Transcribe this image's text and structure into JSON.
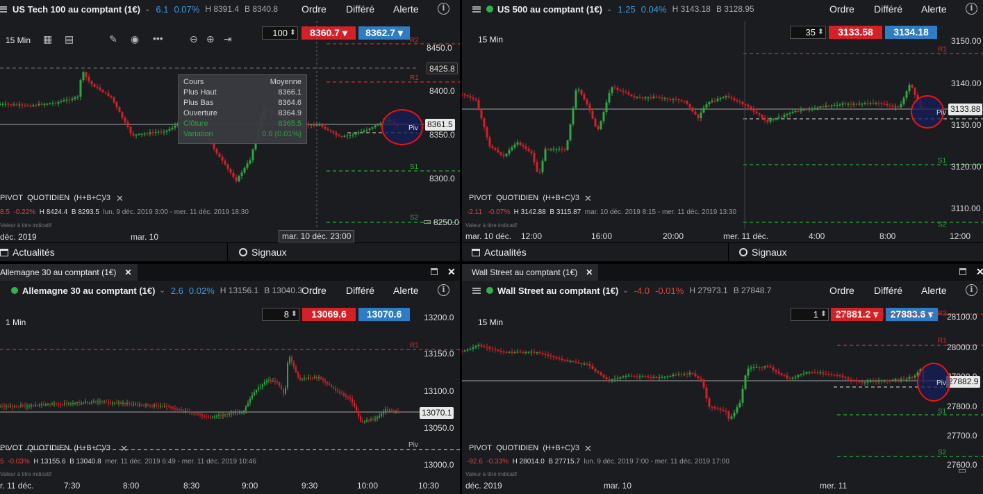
{
  "panes": {
    "p1": {
      "name": "US Tech 100 au comptant (1€)",
      "change": "6.1",
      "change_pct": "0.07%",
      "high": "H 8391.4",
      "low": "B 8340.8",
      "actions": {
        "order": "Ordre",
        "deferred": "Différé",
        "alert": "Alerte"
      },
      "qty": "100",
      "sell": "8360.7 ▾",
      "buy": "8362.7 ▾",
      "timeframe": "15 Min",
      "pivot_label": "PIVOT",
      "pivot_type": "QUOTIDIEN",
      "pivot_formula": "(H+B+C)/3",
      "stats": {
        "change": "8.5",
        "pct": "-0.22%",
        "high": "H 8424.4",
        "low": "B 8293.5",
        "range": "lun. 9 déc. 2019 3:00 - mer. 11 déc. 2019 18:30"
      },
      "disclaimer": "Valeur à titre indicatif",
      "levels": {
        "r2": "R2",
        "r1": "R1",
        "piv": "Piv",
        "s1": "S1",
        "s2": "S2"
      },
      "y_labels": [
        "8450.0",
        "8400.0",
        "8350.0",
        "8300.0",
        "8250.0"
      ],
      "x_labels": [
        "déc. 2019",
        "mar. 10"
      ],
      "crosshair_price": "8425.8",
      "crosshair_time": "mar. 10 déc. 23:00",
      "last_price": "8361.5",
      "tooltip": {
        "rows": [
          {
            "k": "Cours",
            "v": "Moyenne"
          },
          {
            "k": "Plus Haut",
            "v": "8366.1"
          },
          {
            "k": "Plus Bas",
            "v": "8364.6"
          },
          {
            "k": "Ouverture",
            "v": "8364.9"
          },
          {
            "k": "Clôture",
            "v": "8365.5"
          },
          {
            "k": "Variation",
            "v": "0.6 (0.01%)"
          }
        ]
      }
    },
    "p2": {
      "name": "US 500 au comptant (1€)",
      "change": "1.25",
      "change_pct": "0.04%",
      "high": "H 3143.18",
      "low": "B 3128.95",
      "actions": {
        "order": "Ordre",
        "deferred": "Différé",
        "alert": "Alerte"
      },
      "qty": "35",
      "sell": "3133.58",
      "buy": "3134.18",
      "timeframe": "15 Min",
      "pivot_label": "PIVOT",
      "pivot_type": "QUOTIDIEN",
      "pivot_formula": "(H+B+C)/3",
      "stats": {
        "change": "-2.11",
        "pct": "-0.07%",
        "high": "H 3142.88",
        "low": "B 3115.87",
        "range": "mar. 10 déc. 2019 8:15 - mer. 11 déc. 2019 13:30"
      },
      "disclaimer": "Valeur à titre indicatif",
      "levels": {
        "r1": "R1",
        "piv": "Piv",
        "s1": "S1",
        "s2": "S2"
      },
      "y_labels": [
        "3150.00",
        "3140.00",
        "3130.00",
        "3120.00",
        "3110.00"
      ],
      "x_labels": [
        "mar. 10 déc.",
        "12:00",
        "16:00",
        "20:00",
        "mer. 11 déc.",
        "4:00",
        "8:00",
        "12:00"
      ],
      "last_price": "3133.88"
    },
    "p3": {
      "tab": "Allemagne 30 au comptant (1€)",
      "name": "Allemagne 30 au comptant (1€)",
      "change": "2.6",
      "change_pct": "0.02%",
      "high": "H 13156.1",
      "low": "B 13040.3",
      "actions": {
        "order": "Ordre",
        "deferred": "Différé",
        "alert": "Alerte"
      },
      "qty": "8",
      "sell": "13069.6",
      "buy": "13070.6",
      "timeframe": "1 Min",
      "pivot_label": "PIVOT",
      "pivot_type": "QUOTIDIEN",
      "pivot_formula": "(H+B+C)/3",
      "stats": {
        "change": "5",
        "pct": "-0.03%",
        "high": "H 13155.6",
        "low": "B 13040.8",
        "range": "mer. 11 déc. 2019 6:49 - mer. 11 déc. 2019 10:46"
      },
      "disclaimer": "Valeur à titre indicatif",
      "levels": {
        "r1": "R1",
        "piv": "Piv"
      },
      "y_labels": [
        "13200.0",
        "13150.0",
        "13100.0",
        "13050.0",
        "13000.0"
      ],
      "x_labels": [
        "r. 11 déc.",
        "7:30",
        "8:00",
        "8:30",
        "9:00",
        "9:30",
        "10:00",
        "10:30"
      ],
      "last_price": "13070.1"
    },
    "p4": {
      "tab": "Wall Street au comptant (1€)",
      "name": "Wall Street au comptant (1€)",
      "change": "-4.0",
      "change_pct": "-0.01%",
      "high": "H 27973.1",
      "low": "B 27848.7",
      "actions": {
        "order": "Ordre",
        "deferred": "Différé",
        "alert": "Alerte"
      },
      "qty": "1",
      "sell": "27881.2 ▾",
      "buy": "27883.6 ▾",
      "timeframe": "15 Min",
      "pivot_label": "PIVOT",
      "pivot_type": "QUOTIDIEN",
      "pivot_formula": "(H+B+C)/3",
      "stats": {
        "change": "-92.6",
        "pct": "-0.33%",
        "high": "H 28014.0",
        "low": "B 27715.7",
        "range": "lun. 9 déc. 2019 7:00 - mer. 11 déc. 2019 17:00"
      },
      "disclaimer": "Valeur à titre indicatif",
      "levels": {
        "r2": "R2",
        "r1": "R1",
        "piv": "Piv",
        "s1": "S1",
        "s2": "S2"
      },
      "y_labels": [
        "28100.0",
        "28000.0",
        "27900.0",
        "27800.0",
        "27700.0",
        "27600.0"
      ],
      "x_labels": [
        "déc. 2019",
        "mar. 10",
        "mer. 11"
      ],
      "last_price": "27882.9"
    }
  },
  "bottom": {
    "news": "Actualités",
    "signals": "Signaux"
  },
  "colors": {
    "up": "#2ea83e",
    "down": "#d42127",
    "r": "#d42f2f",
    "s": "#2ea83e",
    "accent": "#3a9be0"
  }
}
